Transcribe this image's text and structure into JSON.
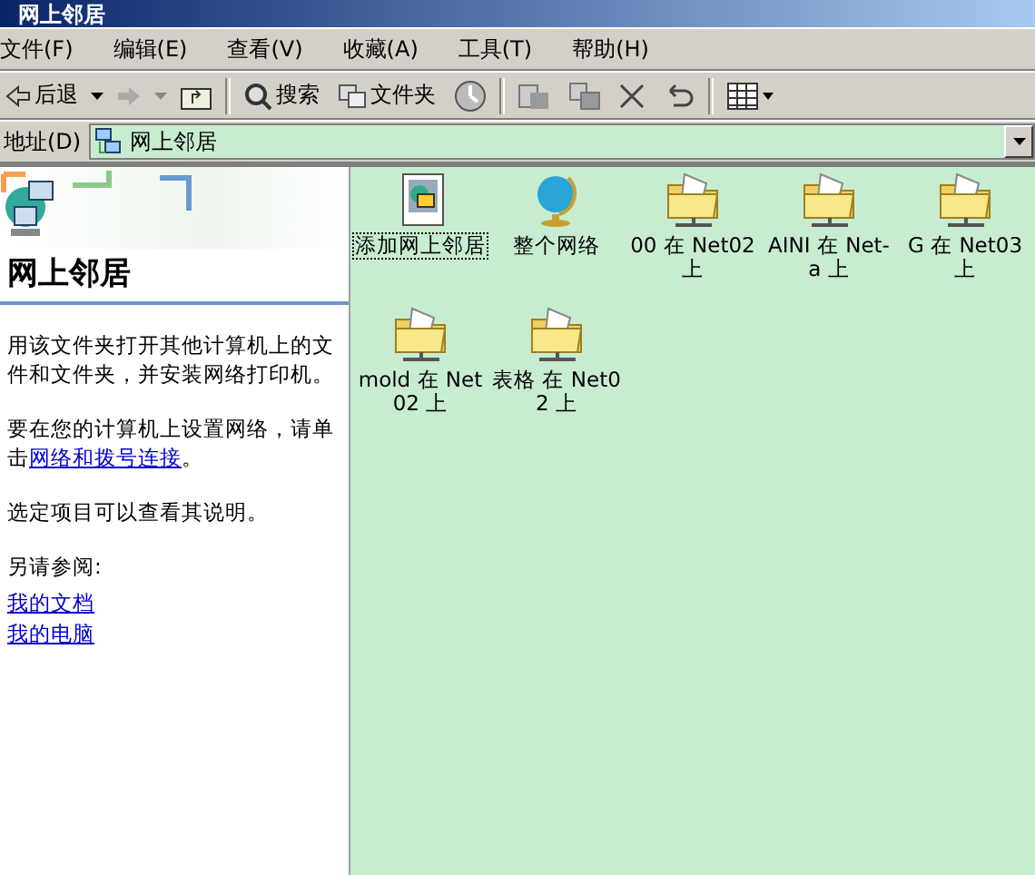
{
  "window": {
    "title": "网上邻居"
  },
  "menu": [
    "文件(F)",
    "编辑(E)",
    "查看(V)",
    "收藏(A)",
    "工具(T)",
    "帮助(H)"
  ],
  "toolbar": [
    {
      "kind": "back",
      "label": "后退",
      "disabled": false
    },
    {
      "kind": "forward",
      "disabled": true
    },
    {
      "kind": "up"
    },
    {
      "kind": "separator"
    },
    {
      "kind": "search",
      "label": "搜索"
    },
    {
      "kind": "folders",
      "label": "文件夹"
    },
    {
      "kind": "history"
    },
    {
      "kind": "separator"
    },
    {
      "kind": "move"
    },
    {
      "kind": "copy"
    },
    {
      "kind": "delete"
    },
    {
      "kind": "undo"
    },
    {
      "kind": "separator"
    },
    {
      "kind": "views"
    }
  ],
  "address": {
    "label": "地址(D)",
    "value": "网上邻居"
  },
  "sidebar": {
    "heading": "网上邻居",
    "paragraphs": [
      {
        "text": "用该文件夹打开其他计算机上的文件和文件夹，并安装网络打印机。"
      },
      {
        "text": "要在您的计算机上设置网络，请单击",
        "link": "网络和拨号连接",
        "end": "。"
      },
      {
        "text": "选定项目可以查看其说明。"
      }
    ],
    "see_also": "另请参阅:",
    "links": [
      "我的文档",
      "我的电脑"
    ]
  },
  "items": [
    {
      "kind": "wizard",
      "label": "添加网上邻居",
      "focused": true
    },
    {
      "kind": "globe",
      "label": "整个网络",
      "focused": false
    },
    {
      "kind": "share",
      "label": "00 在 Net02 上",
      "focused": false
    },
    {
      "kind": "share",
      "label": "AINI 在 Net-a 上",
      "focused": false
    },
    {
      "kind": "share",
      "label": "G 在 Net03 上",
      "focused": false
    },
    {
      "kind": "share",
      "label": "mold 在 Net02 上",
      "focused": false
    },
    {
      "kind": "share",
      "label": "表格 在 Net02 上",
      "focused": false
    }
  ]
}
